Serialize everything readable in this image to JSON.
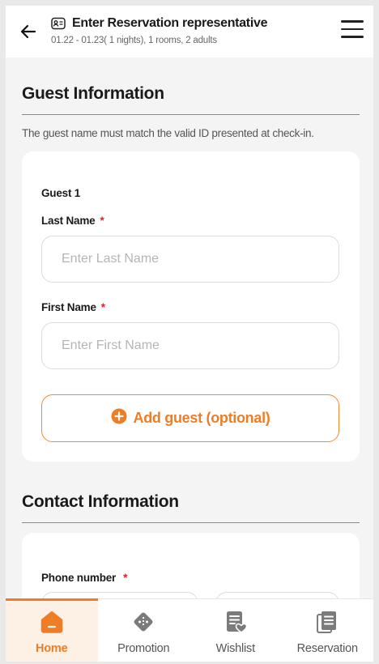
{
  "header": {
    "title": "Enter Reservation representative",
    "subtitle": "01.22 - 01.23( 1 nights), 1 rooms, 2 adults"
  },
  "guest_section": {
    "title": "Guest Information",
    "note": "The guest name must match the valid ID presented at check-in.",
    "guest_heading": "Guest 1",
    "last_name_label": "Last Name",
    "last_name_placeholder": "Enter Last Name",
    "last_name_value": "",
    "first_name_label": "First Name",
    "first_name_placeholder": "Enter First Name",
    "first_name_value": "",
    "required_mark": "*",
    "add_guest_label": "Add guest (optional)"
  },
  "contact_section": {
    "title": "Contact Information",
    "phone_label": "Phone number",
    "required_mark": "*"
  },
  "tabbar": {
    "items": [
      {
        "label": "Home",
        "icon": "home-icon",
        "active": true
      },
      {
        "label": "Promotion",
        "icon": "promotion-tag-icon",
        "active": false
      },
      {
        "label": "Wishlist",
        "icon": "wishlist-icon",
        "active": false
      },
      {
        "label": "Reservation",
        "icon": "reservation-icon",
        "active": false
      }
    ]
  },
  "colors": {
    "accent": "#ee7d26",
    "required": "#e02020",
    "background": "#f4f4f4"
  }
}
